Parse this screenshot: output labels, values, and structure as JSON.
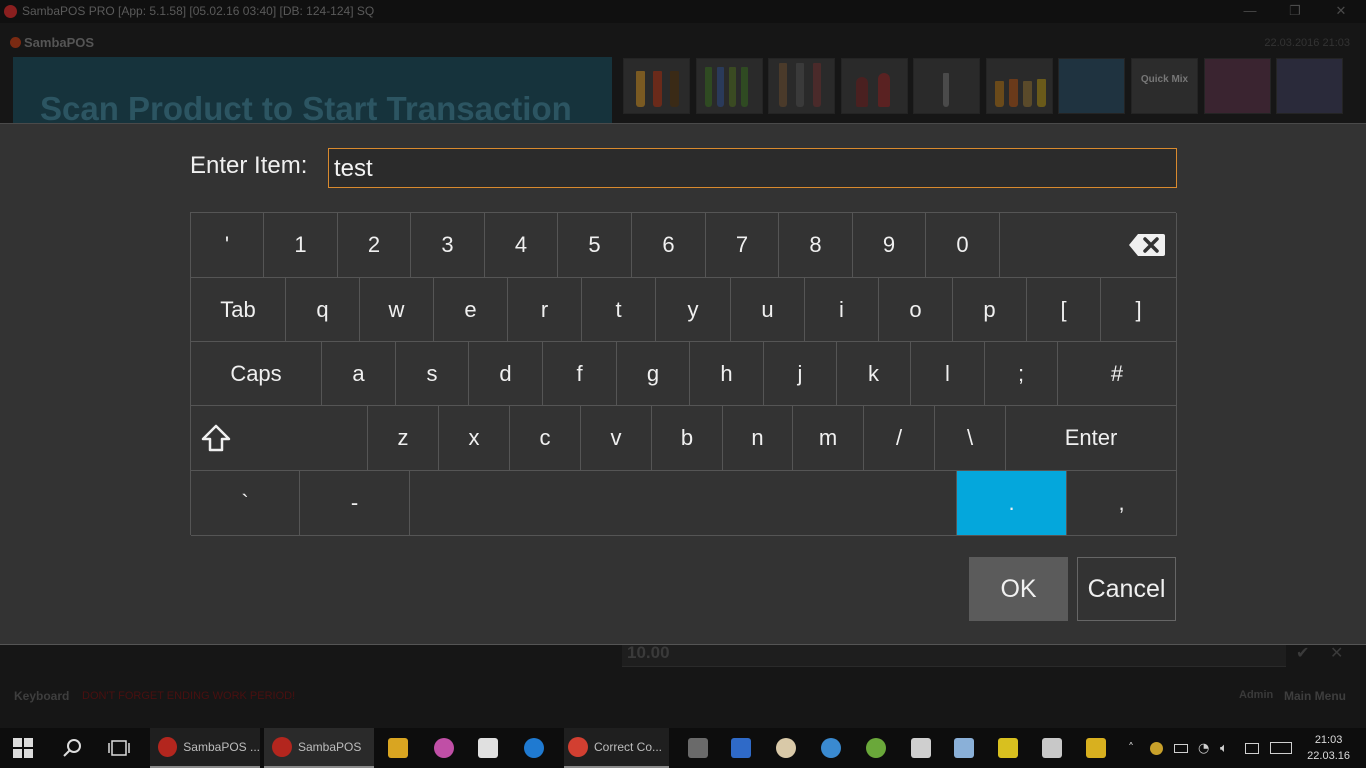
{
  "window": {
    "title": "SambaPOS PRO [App: 5.1.58] [05.02.16 03:40] [DB: 124-124] SQ",
    "controls": [
      "minimize-icon",
      "restore-icon",
      "close-icon"
    ]
  },
  "background": {
    "brand": "SambaPOS",
    "date": "22.03.2016 21:03",
    "banner_text": "Scan Product to Start Transaction",
    "categories": [
      {
        "icon": "beer-glasses-icon"
      },
      {
        "icon": "beer-bottles-icon"
      },
      {
        "icon": "liquor-bottles-icon"
      },
      {
        "icon": "wine-glasses-icon"
      },
      {
        "icon": "cocktail-glass-icon"
      },
      {
        "icon": "shots-icon"
      },
      {
        "icon": "snacks-icon"
      },
      {
        "label": "Quick Mix"
      },
      {
        "icon": "cans-icon"
      },
      {
        "icon": "soda-cans-icon"
      }
    ],
    "amount_value": "10.00",
    "keyboard_label": "Keyboard",
    "warning": "DON'T FORGET ENDING WORK PERIOD!",
    "admin": "Admin",
    "main_menu": "Main Menu"
  },
  "dialog": {
    "prompt": "Enter Item:",
    "input_value": "test",
    "ok_label": "OK",
    "cancel_label": "Cancel",
    "active_key_color": "#04a7dc",
    "input_border_color": "#d98a2e"
  },
  "keyboard": {
    "row1": [
      "'",
      "1",
      "2",
      "3",
      "4",
      "5",
      "6",
      "7",
      "8",
      "9",
      "0",
      "backspace-icon"
    ],
    "row2": [
      "Tab",
      "q",
      "w",
      "e",
      "r",
      "t",
      "y",
      "u",
      "i",
      "o",
      "p",
      "[",
      "]"
    ],
    "row3": [
      "Caps",
      "a",
      "s",
      "d",
      "f",
      "g",
      "h",
      "j",
      "k",
      "l",
      ";",
      "#"
    ],
    "row4": [
      "shift-icon",
      "z",
      "x",
      "c",
      "v",
      "b",
      "n",
      "m",
      "/",
      "\\",
      "Enter"
    ],
    "row5": [
      "`",
      "-",
      "space",
      ".",
      ","
    ],
    "active_key": "."
  },
  "taskbar": {
    "items": [
      {
        "icon": "windows-start-icon"
      },
      {
        "icon": "search-icon"
      },
      {
        "icon": "task-view-icon"
      },
      {
        "icon": "sambapos-icon",
        "label": "SambaPOS ..."
      },
      {
        "icon": "sambapos-icon",
        "label": "SambaPOS"
      },
      {
        "icon": "file-explorer-icon"
      },
      {
        "icon": "itunes-icon"
      },
      {
        "icon": "store-icon"
      },
      {
        "icon": "edge-icon"
      },
      {
        "icon": "chrome-icon",
        "label": "Correct Co..."
      },
      {
        "icon": "app-icon"
      },
      {
        "icon": "visual-studio-icon"
      },
      {
        "icon": "paint-icon"
      },
      {
        "icon": "database-icon"
      },
      {
        "icon": "sql-icon"
      },
      {
        "icon": "calculator-icon"
      },
      {
        "icon": "notes-icon"
      },
      {
        "icon": "pointer-icon"
      },
      {
        "icon": "touch-icon"
      },
      {
        "icon": "tools-icon"
      }
    ],
    "tray": [
      "chevron-up-icon",
      "chrome-tray-icon",
      "power-icon",
      "wifi-icon",
      "volume-icon",
      "notification-icon",
      "keyboard-icon"
    ],
    "time": "21:03",
    "date": "22.03.16"
  }
}
